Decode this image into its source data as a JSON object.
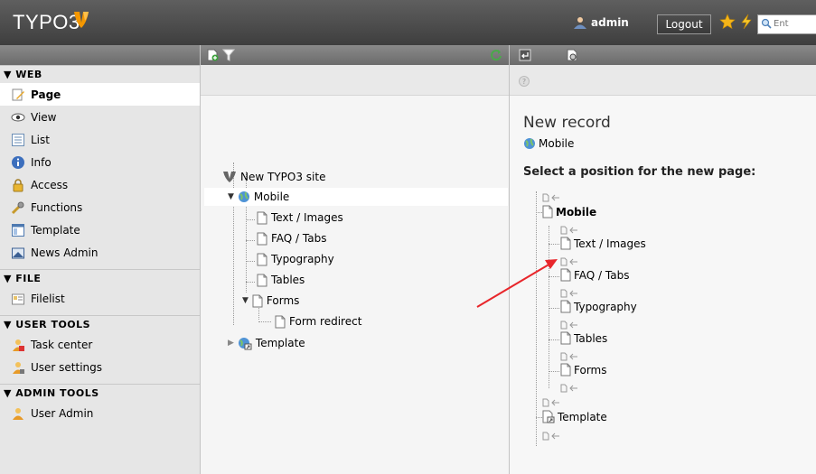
{
  "topbar": {
    "logo_text": "TYPO3",
    "username": "admin",
    "logout_label": "Logout",
    "search_placeholder": "Ent"
  },
  "modmenu": {
    "groups": [
      {
        "title": "▼ WEB",
        "items": [
          {
            "label": "Page",
            "icon": "page-edit-icon",
            "active": true
          },
          {
            "label": "View",
            "icon": "eye-icon"
          },
          {
            "label": "List",
            "icon": "list-icon"
          },
          {
            "label": "Info",
            "icon": "info-icon"
          },
          {
            "label": "Access",
            "icon": "lock-icon"
          },
          {
            "label": "Functions",
            "icon": "wrench-icon"
          },
          {
            "label": "Template",
            "icon": "template-icon"
          },
          {
            "label": "News Admin",
            "icon": "news-icon"
          }
        ]
      },
      {
        "title": "▼ FILE",
        "items": [
          {
            "label": "Filelist",
            "icon": "filelist-icon"
          }
        ]
      },
      {
        "title": "▼ USER TOOLS",
        "items": [
          {
            "label": "Task center",
            "icon": "task-center-icon"
          },
          {
            "label": "User settings",
            "icon": "user-settings-icon"
          }
        ]
      },
      {
        "title": "▼ ADMIN TOOLS",
        "items": [
          {
            "label": "User Admin",
            "icon": "user-admin-icon"
          }
        ]
      }
    ]
  },
  "tree": {
    "root": "New TYPO3 site",
    "mobile": "Mobile",
    "children": [
      "Text / Images",
      "FAQ / Tabs",
      "Typography",
      "Tables",
      "Forms"
    ],
    "form_child": "Form redirect",
    "template": "Template"
  },
  "content": {
    "title": "New record",
    "page": "Mobile",
    "heading": "Select a position for the new page:",
    "root_page": "Mobile",
    "sub_pages": [
      "Text / Images",
      "FAQ / Tabs",
      "Typography",
      "Tables",
      "Forms"
    ],
    "sibling_page": "Template"
  },
  "colors": {
    "topbar": "#4a4a4a",
    "orange_accent": "#f49700",
    "arrow": "#e8262b"
  }
}
